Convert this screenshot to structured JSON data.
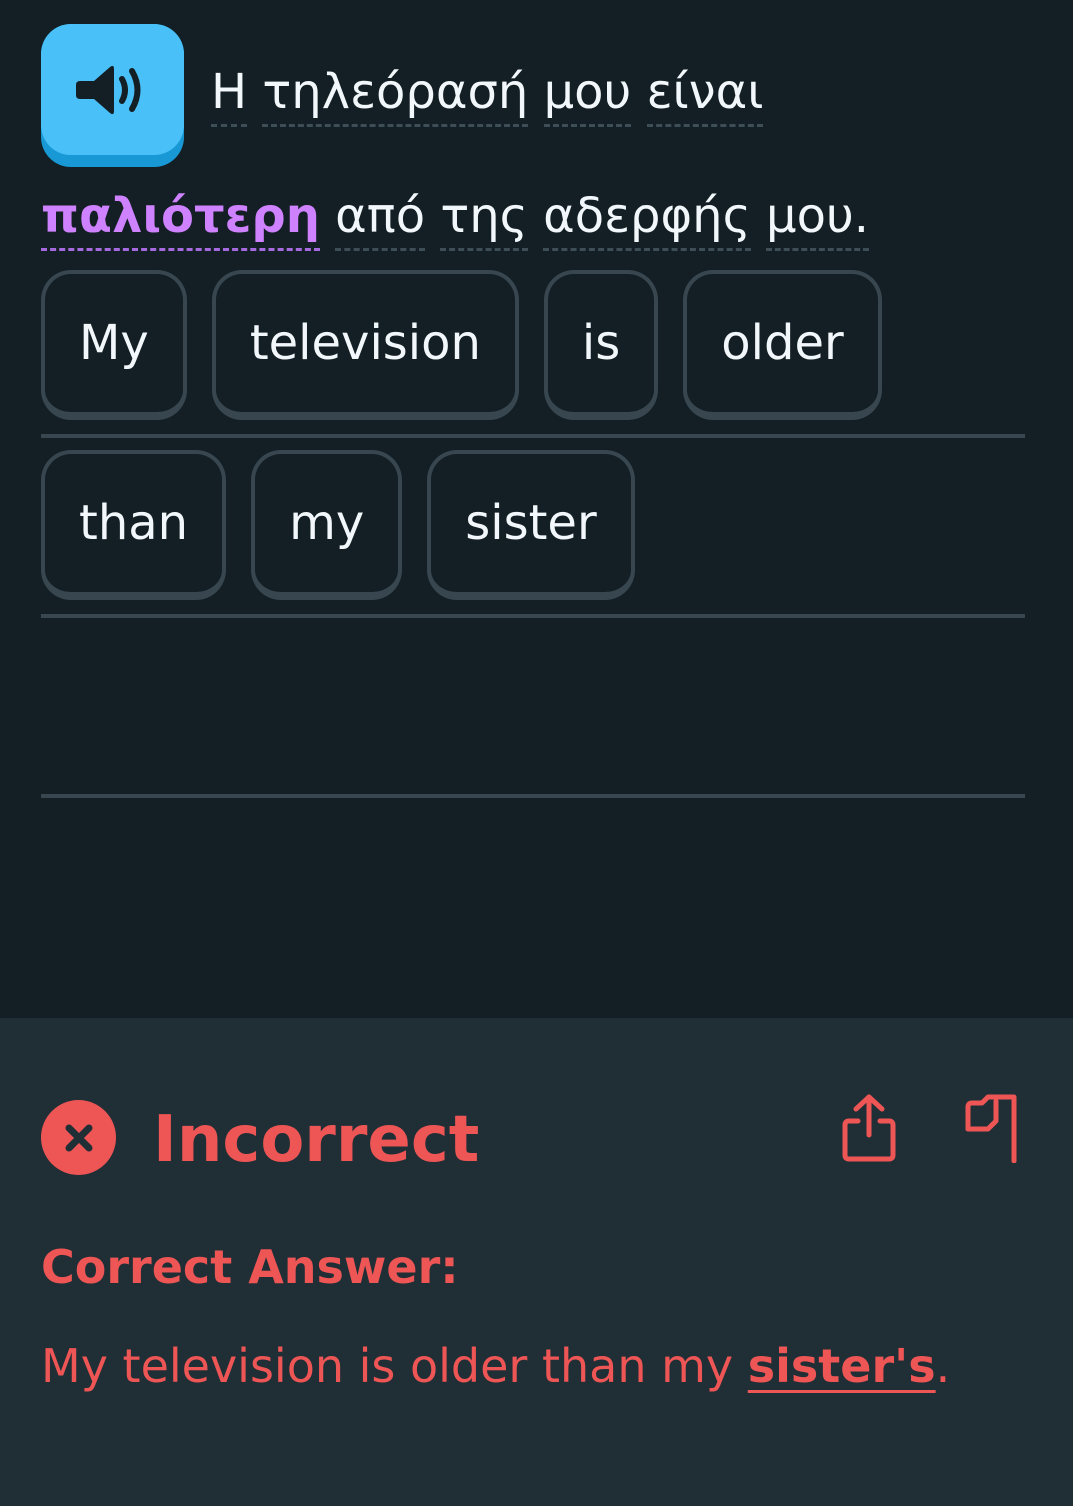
{
  "prompt": {
    "line1_words": [
      "Η",
      "τηλεόρασή",
      "μου",
      "είναι"
    ],
    "highlighted_word": "παλιότερη",
    "line2_words": [
      "από",
      "της",
      "αδερφής",
      "μου."
    ]
  },
  "answer_tiles": {
    "row1": [
      "My",
      "television",
      "is",
      "older"
    ],
    "row2": [
      "than",
      "my",
      "sister"
    ]
  },
  "feedback": {
    "status": "Incorrect",
    "correct_answer_label": "Correct Answer:",
    "correct_answer_text": "My television is older than my",
    "correct_answer_diff": "sister's",
    "correct_answer_end": "."
  },
  "icons": {
    "speaker": "speaker-icon",
    "status": "x-circle-icon",
    "share": "share-icon",
    "flag": "flag-icon"
  },
  "colors": {
    "background": "#131f24",
    "feedback_background": "#202f36",
    "accent_blue": "#49c0f8",
    "highlight_purple": "#ce82ff",
    "error_red": "#ee5555",
    "tile_border": "#37464f"
  }
}
